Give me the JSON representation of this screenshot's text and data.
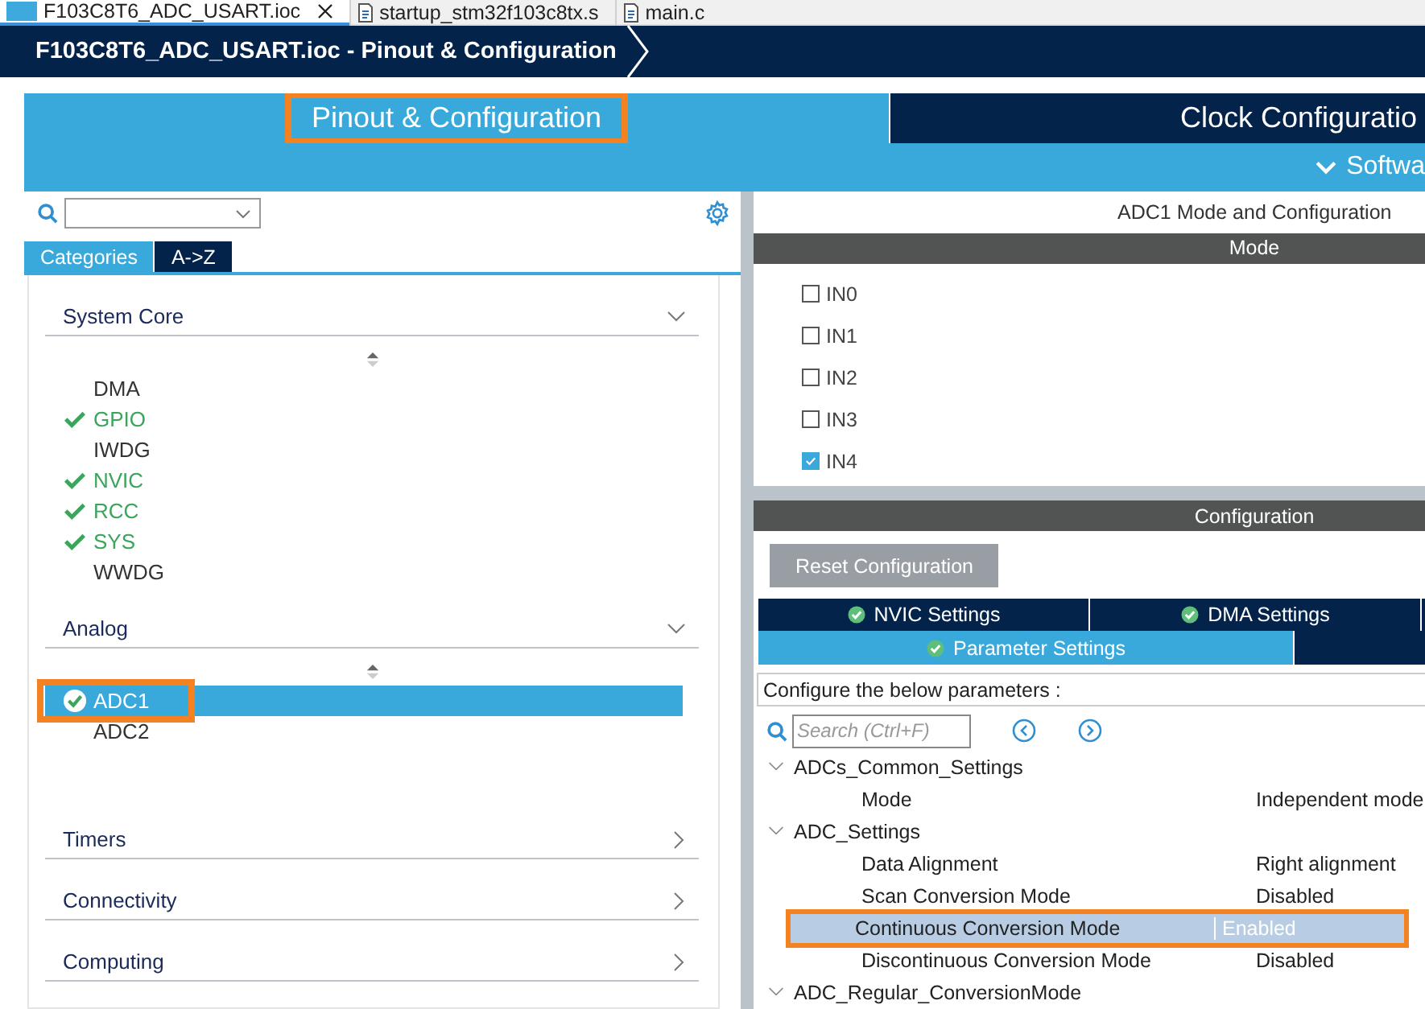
{
  "editor_tabs": [
    {
      "label": "F103C8T6_ADC_USART.ioc",
      "kind": "mx",
      "selected": true,
      "closable": true
    },
    {
      "label": "startup_stm32f103c8tx.s",
      "kind": "s",
      "selected": false,
      "closable": false
    },
    {
      "label": "main.c",
      "kind": "c",
      "selected": false,
      "closable": false
    }
  ],
  "breadcrumb": "F103C8T6_ADC_USART.ioc - Pinout & Configuration",
  "main_tabs": [
    {
      "label": "Pinout & Configuration",
      "selected": true,
      "highlighted": true
    },
    {
      "label": "Clock Configuratio",
      "selected": false,
      "highlighted": false
    }
  ],
  "sub_bar": {
    "label": "Softwa"
  },
  "left": {
    "category_tabs": [
      {
        "label": "Categories",
        "selected": true
      },
      {
        "label": "A->Z",
        "selected": false
      }
    ],
    "sections": [
      {
        "title": "System Core",
        "expanded": true,
        "items": [
          {
            "label": "DMA",
            "enabled": false,
            "selected": false,
            "highlighted": false
          },
          {
            "label": "GPIO",
            "enabled": true,
            "selected": false,
            "highlighted": false
          },
          {
            "label": "IWDG",
            "enabled": false,
            "selected": false,
            "highlighted": false
          },
          {
            "label": "NVIC",
            "enabled": true,
            "selected": false,
            "highlighted": false
          },
          {
            "label": "RCC",
            "enabled": true,
            "selected": false,
            "highlighted": false
          },
          {
            "label": "SYS",
            "enabled": true,
            "selected": false,
            "highlighted": false
          },
          {
            "label": "WWDG",
            "enabled": false,
            "selected": false,
            "highlighted": false
          }
        ]
      },
      {
        "title": "Analog",
        "expanded": true,
        "items": [
          {
            "label": "ADC1",
            "enabled": true,
            "selected": true,
            "highlighted": true
          },
          {
            "label": "ADC2",
            "enabled": false,
            "selected": false,
            "highlighted": false
          }
        ]
      },
      {
        "title": "Timers",
        "expanded": false
      },
      {
        "title": "Connectivity",
        "expanded": false
      },
      {
        "title": "Computing",
        "expanded": false
      }
    ]
  },
  "right": {
    "title": "ADC1 Mode and Configuration",
    "mode_header": "Mode",
    "channels": [
      {
        "label": "IN0",
        "checked": false
      },
      {
        "label": "IN1",
        "checked": false
      },
      {
        "label": "IN2",
        "checked": false
      },
      {
        "label": "IN3",
        "checked": false
      },
      {
        "label": "IN4",
        "checked": true
      }
    ],
    "config_header": "Configuration",
    "reset_button": "Reset Configuration",
    "settings_tabs": [
      {
        "label": "NVIC Settings",
        "selected": false
      },
      {
        "label": "DMA Settings",
        "selected": false
      },
      {
        "label": "Parameter Settings",
        "selected": true
      }
    ],
    "info": "Configure the below parameters :",
    "search": {
      "placeholder": "Search (Ctrl+F)"
    },
    "parameters": [
      {
        "label": "ADCs_Common_Settings",
        "expanded": true,
        "children": [
          {
            "label": "Mode",
            "value": "Independent mode",
            "selected": false,
            "highlighted": false
          }
        ]
      },
      {
        "label": "ADC_Settings",
        "expanded": true,
        "children": [
          {
            "label": "Data Alignment",
            "value": "Right alignment",
            "selected": false,
            "highlighted": false
          },
          {
            "label": "Scan Conversion Mode",
            "value": "Disabled",
            "selected": false,
            "highlighted": false
          },
          {
            "label": "Continuous Conversion Mode",
            "value": "Enabled",
            "selected": true,
            "highlighted": true
          },
          {
            "label": "Discontinuous Conversion Mode",
            "value": "Disabled",
            "selected": false,
            "highlighted": false
          }
        ]
      },
      {
        "label": "ADC_Regular_ConversionMode",
        "expanded": true
      }
    ]
  }
}
